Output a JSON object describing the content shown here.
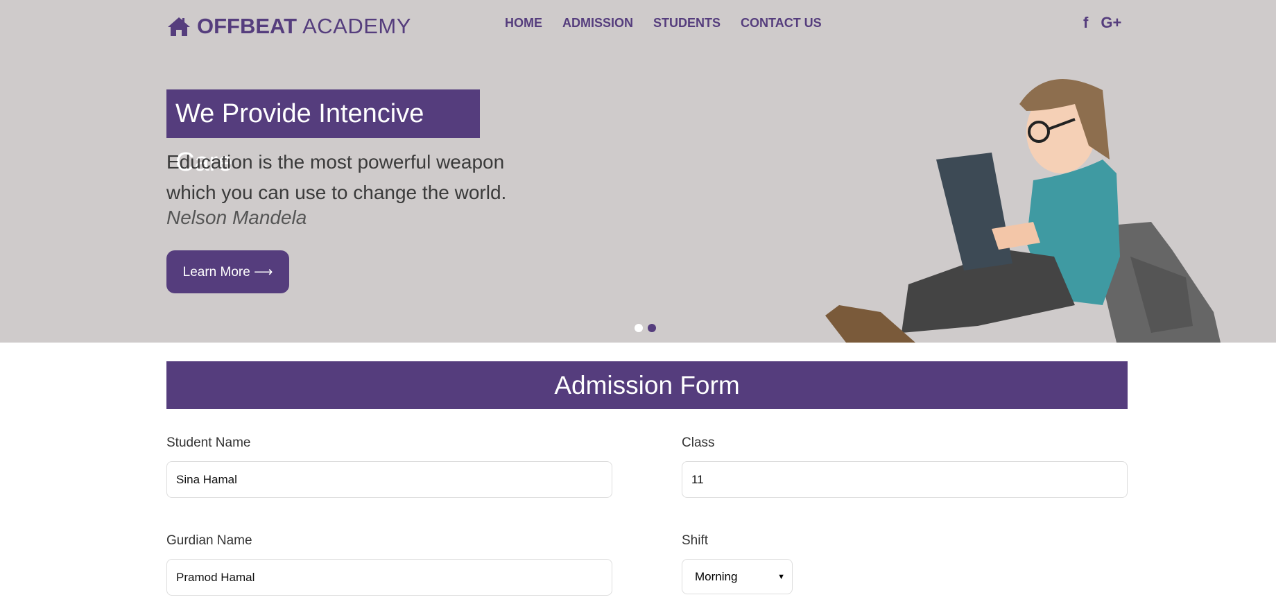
{
  "brand": {
    "bold": "OFFBEAT",
    "light": "ACADEMY",
    "icon": "home-icon"
  },
  "nav": [
    {
      "label": "HOME"
    },
    {
      "label": "ADMISSION"
    },
    {
      "label": "STUDENTS"
    },
    {
      "label": "CONTACT US"
    }
  ],
  "social": {
    "facebook": "f",
    "google": "G+"
  },
  "hero": {
    "title": "We Provide Intencive Care",
    "quote_line1": "Education is the most powerful weapon",
    "quote_line2": "which you can use to change the world.",
    "author": "Nelson Mandela",
    "button": "Learn More ⟶",
    "slides": 2,
    "active_slide": 2
  },
  "form": {
    "title": "Admission Form",
    "student_name": {
      "label": "Student Name",
      "value": "Sina Hamal"
    },
    "class": {
      "label": "Class",
      "value": "11"
    },
    "guardian_name": {
      "label": "Gurdian Name",
      "value": "Pramod Hamal"
    },
    "shift": {
      "label": "Shift",
      "value": "Morning"
    }
  },
  "colors": {
    "accent": "#553d7d",
    "hero_bg": "#cfcbcb"
  }
}
